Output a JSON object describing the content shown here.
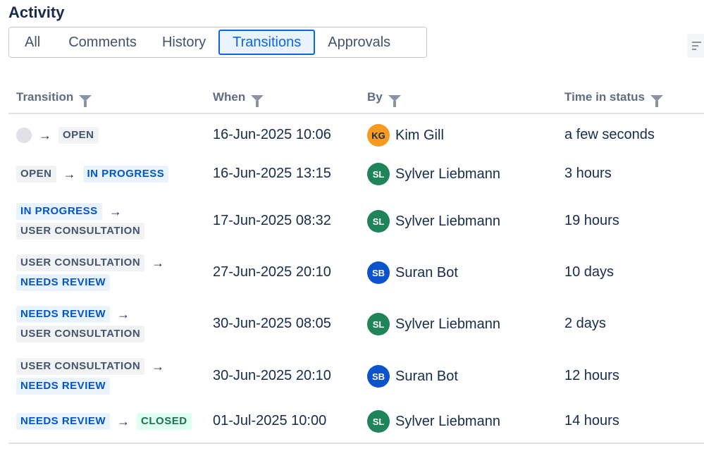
{
  "section": {
    "title": "Activity"
  },
  "tabs": [
    {
      "label": "All",
      "active": false
    },
    {
      "label": "Comments",
      "active": false
    },
    {
      "label": "History",
      "active": false
    },
    {
      "label": "Transitions",
      "active": true
    },
    {
      "label": "Approvals",
      "active": false
    }
  ],
  "table": {
    "headers": [
      "Transition",
      "When",
      "By",
      "Time in status"
    ],
    "rows": [
      {
        "from": "",
        "to": "OPEN",
        "when": "16-Jun-2025 10:06",
        "by_initials": "KG",
        "by": "Kim Gill",
        "time": "a few seconds"
      },
      {
        "from": "OPEN",
        "to": "IN PROGRESS",
        "when": "16-Jun-2025 13:15",
        "by_initials": "SL",
        "by": "Sylver Liebmann",
        "time": "3 hours"
      },
      {
        "from": "IN PROGRESS",
        "to": "USER CONSULTATION",
        "when": "17-Jun-2025 08:32",
        "by_initials": "SL",
        "by": "Sylver Liebmann",
        "time": "19 hours"
      },
      {
        "from": "USER CONSULTATION",
        "to": "NEEDS REVIEW",
        "when": "27-Jun-2025 20:10",
        "by_initials": "SB",
        "by": "Suran Bot",
        "time": "10 days"
      },
      {
        "from": "NEEDS REVIEW",
        "to": "USER CONSULTATION",
        "when": "30-Jun-2025 08:05",
        "by_initials": "SL",
        "by": "Sylver Liebmann",
        "time": "2 days"
      },
      {
        "from": "USER CONSULTATION",
        "to": "NEEDS REVIEW",
        "when": "30-Jun-2025 20:10",
        "by_initials": "SB",
        "by": "Suran Bot",
        "time": "12 hours"
      },
      {
        "from": "NEEDS REVIEW",
        "to": "CLOSED",
        "when": "01-Jul-2025 10:00",
        "by_initials": "SL",
        "by": "Sylver Liebmann",
        "time": "14 hours"
      }
    ]
  },
  "colors": {
    "status_grey_bg": "#f1f2f4",
    "status_blue_bg": "#e9f2ff",
    "status_green_bg": "#dcfff1",
    "avatar_kg": "#f79a20",
    "avatar_sl": "#1f845a",
    "avatar_sb": "#0c52cc"
  },
  "icons": {
    "arrow": "arrow-right-icon",
    "filter": "filter-icon",
    "sort": "sort-icon"
  }
}
